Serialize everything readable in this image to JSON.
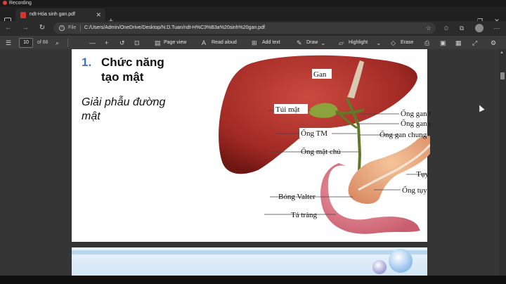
{
  "recording": {
    "label": "Recording"
  },
  "browser": {
    "tab_title": "ndt-Hóa sinh gan.pdf",
    "url_scheme": "File",
    "url": "C:/Users/Admin/OneDrive/Desktop/N.D.Tuan/ndt-H%C3%B3a%20sinh%20gan.pdf"
  },
  "pdf_toolbar": {
    "current_page": "10",
    "page_total": "of 66",
    "page_view": "Page view",
    "read_aloud": "Read aloud",
    "add_text": "Add text",
    "draw": "Draw",
    "highlight": "Highlight",
    "erase": "Erase"
  },
  "slide": {
    "number": "1.",
    "title": "Chức năng tạo mật",
    "subtitle": "Giải phẫu đường mật"
  },
  "diagram": {
    "labels": {
      "gan": "Gan",
      "tui_mat": "Túi mật",
      "ong_tm": "Ống TM",
      "ong_mat_chu": "Ống mật chủ",
      "bong_valter": "Bóng Valter",
      "ta_trang": "Tá tràng",
      "ong_gan_trai": "Ống gan trái",
      "ong_gan_phai": "Ống gan phải",
      "ong_gan_chung": "Ống gan chung",
      "tuy": "Tụy",
      "ong_tuy": "Ống tụy"
    }
  }
}
